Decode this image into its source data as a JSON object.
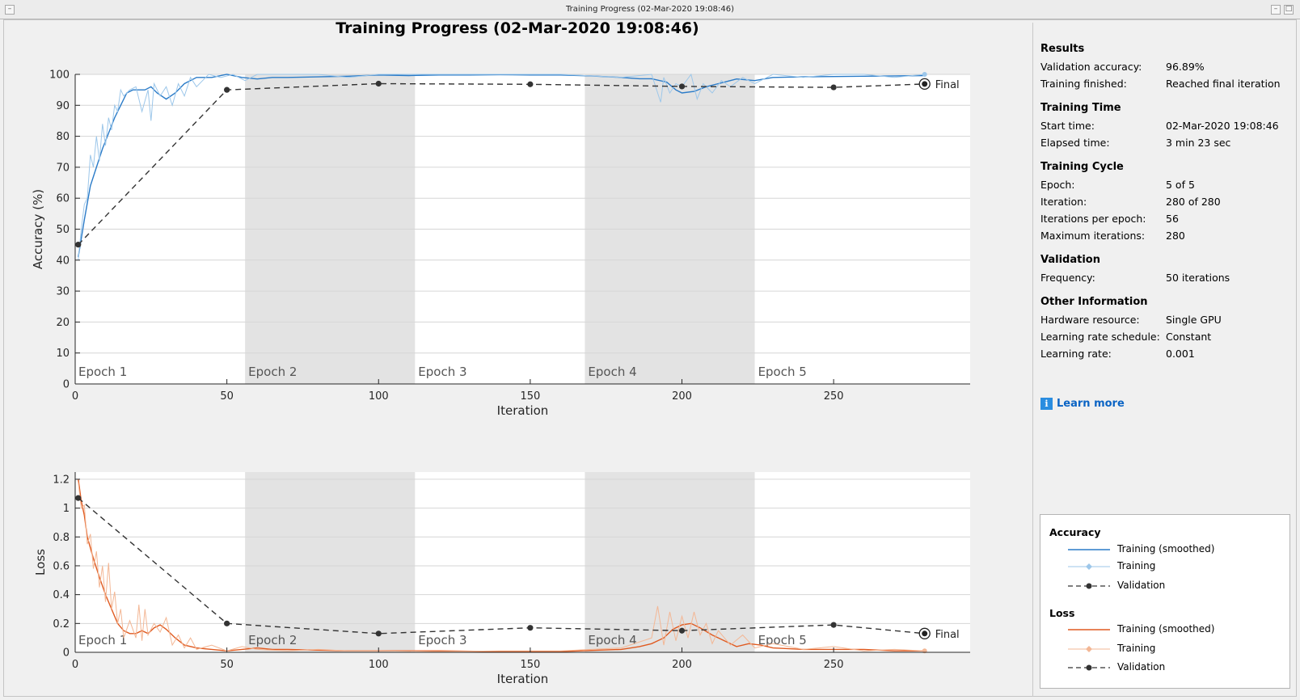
{
  "window": {
    "title": "Training Progress (02-Mar-2020 19:08:46)"
  },
  "main_title": "Training Progress (02-Mar-2020 19:08:46)",
  "colors": {
    "accuracy_smoothed": "#2a7bc8",
    "accuracy_raw": "#9dc7ea",
    "loss_smoothed": "#e05a20",
    "loss_raw": "#f3b795",
    "validation": "#333333",
    "epoch_shade": "#e3e3e3"
  },
  "chart_data": [
    {
      "type": "line",
      "name": "accuracy",
      "xlabel": "Iteration",
      "ylabel": "Accuracy (%)",
      "xlim": [
        0,
        295
      ],
      "ylim": [
        0,
        100
      ],
      "xticks": [
        0,
        50,
        100,
        150,
        200,
        250
      ],
      "yticks": [
        0,
        10,
        20,
        30,
        40,
        50,
        60,
        70,
        80,
        90,
        100
      ],
      "ytick_labels": [
        "0",
        "10",
        "20",
        "30",
        "40",
        "50",
        "60",
        "70",
        "80",
        "90",
        "100"
      ],
      "epochs": [
        "Epoch 1",
        "Epoch 2",
        "Epoch 3",
        "Epoch 4",
        "Epoch 5"
      ],
      "epoch_bounds": [
        0,
        56,
        112,
        168,
        224,
        280
      ],
      "final_label": "Final",
      "series": [
        {
          "name": "Training (smoothed)",
          "style": "smoothed",
          "x": [
            1,
            3,
            5,
            7,
            9,
            11,
            13,
            15,
            17,
            19,
            21,
            23,
            25,
            27,
            30,
            33,
            36,
            40,
            45,
            50,
            55,
            60,
            65,
            70,
            80,
            90,
            100,
            110,
            120,
            130,
            140,
            150,
            160,
            170,
            180,
            186,
            190,
            195,
            198,
            200,
            204,
            208,
            212,
            218,
            224,
            230,
            240,
            250,
            260,
            270,
            280
          ],
          "y": [
            41,
            53,
            64,
            70,
            76,
            81,
            86,
            90,
            94,
            95,
            95,
            95,
            96,
            94,
            92,
            94,
            97,
            99,
            99,
            100,
            99,
            98.5,
            99,
            99,
            99.2,
            99.4,
            99.8,
            99.6,
            99.8,
            99.8,
            99.9,
            99.8,
            99.8,
            99.5,
            99,
            98.6,
            98.6,
            97.5,
            95,
            94,
            94.5,
            96,
            97,
            98.5,
            98,
            99,
            99.2,
            99.3,
            99.4,
            99.5,
            99.6
          ]
        },
        {
          "name": "Training",
          "style": "raw",
          "x": [
            1,
            2,
            3,
            4,
            5,
            6,
            7,
            8,
            9,
            10,
            11,
            12,
            13,
            14,
            15,
            16,
            18,
            20,
            22,
            24,
            25,
            26,
            28,
            30,
            32,
            34,
            36,
            38,
            40,
            44,
            48,
            52,
            56,
            60,
            70,
            80,
            90,
            100,
            120,
            140,
            160,
            180,
            190,
            193,
            194,
            196,
            198,
            200,
            203,
            205,
            207,
            210,
            213,
            216,
            220,
            224,
            230,
            240,
            250,
            260,
            270,
            280
          ],
          "y": [
            40,
            50,
            58,
            60,
            74,
            70,
            80,
            72,
            84,
            77,
            86,
            82,
            90,
            88,
            95,
            93,
            95,
            96,
            88,
            95,
            85,
            97,
            93,
            96,
            90,
            97,
            93,
            99,
            96,
            100,
            99,
            100,
            98,
            100,
            100,
            100,
            99,
            100,
            100,
            100,
            100,
            99,
            100,
            91,
            99,
            94,
            97,
            96,
            100,
            92,
            97,
            94,
            98,
            96,
            99,
            97,
            100,
            99,
            100,
            100,
            99,
            100
          ]
        },
        {
          "name": "Validation",
          "style": "validation",
          "x": [
            1,
            50,
            100,
            150,
            200,
            250,
            280
          ],
          "y": [
            45,
            95,
            97,
            96.8,
            96.1,
            95.8,
            96.9
          ]
        }
      ]
    },
    {
      "type": "line",
      "name": "loss",
      "xlabel": "Iteration",
      "ylabel": "Loss",
      "xlim": [
        0,
        295
      ],
      "ylim": [
        0,
        1.25
      ],
      "xticks": [
        0,
        50,
        100,
        150,
        200,
        250
      ],
      "yticks": [
        0,
        0.2,
        0.4,
        0.6,
        0.8,
        1.0,
        1.2
      ],
      "ytick_labels": [
        "0",
        "0.2",
        "0.4",
        "0.6",
        "0.8",
        "1",
        "1.2"
      ],
      "epochs": [
        "Epoch 1",
        "Epoch 2",
        "Epoch 3",
        "Epoch 4",
        "Epoch 5"
      ],
      "epoch_bounds": [
        0,
        56,
        112,
        168,
        224,
        280
      ],
      "final_label": "Final",
      "series": [
        {
          "name": "Training (smoothed)",
          "style": "smoothed",
          "x": [
            1,
            2,
            3,
            4,
            6,
            8,
            10,
            12,
            14,
            16,
            18,
            20,
            22,
            24,
            26,
            28,
            30,
            33,
            36,
            40,
            45,
            50,
            55,
            60,
            65,
            70,
            80,
            90,
            100,
            120,
            140,
            160,
            180,
            186,
            190,
            194,
            197,
            200,
            203,
            206,
            210,
            214,
            218,
            222,
            226,
            230,
            240,
            250,
            260,
            270,
            280
          ],
          "y": [
            1.2,
            1.05,
            0.95,
            0.8,
            0.65,
            0.52,
            0.4,
            0.3,
            0.2,
            0.15,
            0.13,
            0.13,
            0.15,
            0.13,
            0.17,
            0.19,
            0.16,
            0.1,
            0.05,
            0.03,
            0.02,
            0.01,
            0.02,
            0.03,
            0.02,
            0.02,
            0.015,
            0.01,
            0.01,
            0.01,
            0.005,
            0.005,
            0.02,
            0.04,
            0.06,
            0.1,
            0.16,
            0.19,
            0.2,
            0.17,
            0.12,
            0.08,
            0.04,
            0.06,
            0.05,
            0.03,
            0.02,
            0.02,
            0.02,
            0.01,
            0.01
          ]
        },
        {
          "name": "Training",
          "style": "raw",
          "x": [
            1,
            2,
            3,
            4,
            5,
            6,
            7,
            8,
            9,
            10,
            11,
            12,
            13,
            14,
            15,
            16,
            18,
            20,
            21,
            22,
            23,
            24,
            26,
            28,
            30,
            32,
            34,
            36,
            38,
            40,
            45,
            50,
            55,
            60,
            70,
            80,
            90,
            100,
            120,
            140,
            160,
            180,
            190,
            192,
            194,
            196,
            198,
            200,
            202,
            204,
            206,
            208,
            210,
            212,
            216,
            220,
            224,
            230,
            240,
            250,
            260,
            270,
            280
          ],
          "y": [
            1.18,
            1.0,
            1.02,
            0.75,
            0.82,
            0.58,
            0.7,
            0.45,
            0.6,
            0.35,
            0.62,
            0.3,
            0.42,
            0.2,
            0.3,
            0.1,
            0.22,
            0.1,
            0.33,
            0.08,
            0.3,
            0.12,
            0.2,
            0.14,
            0.24,
            0.05,
            0.12,
            0.03,
            0.1,
            0.02,
            0.05,
            0.01,
            0.04,
            0.02,
            0.01,
            0.02,
            0.01,
            0.01,
            0.005,
            0.01,
            0.01,
            0.03,
            0.1,
            0.32,
            0.05,
            0.28,
            0.08,
            0.25,
            0.1,
            0.28,
            0.12,
            0.2,
            0.06,
            0.15,
            0.05,
            0.12,
            0.03,
            0.06,
            0.02,
            0.04,
            0.01,
            0.02,
            0.01
          ]
        },
        {
          "name": "Validation",
          "style": "validation",
          "x": [
            1,
            50,
            100,
            150,
            200,
            250,
            280
          ],
          "y": [
            1.07,
            0.2,
            0.13,
            0.17,
            0.15,
            0.19,
            0.13
          ]
        }
      ]
    }
  ],
  "panel": {
    "results": {
      "heading": "Results",
      "rows": [
        {
          "label": "Validation accuracy:",
          "value": "96.89%"
        },
        {
          "label": "Training finished:",
          "value": "Reached final iteration"
        }
      ]
    },
    "training_time": {
      "heading": "Training Time",
      "rows": [
        {
          "label": "Start time:",
          "value": "02-Mar-2020 19:08:46"
        },
        {
          "label": "Elapsed time:",
          "value": "3 min 23 sec"
        }
      ]
    },
    "training_cycle": {
      "heading": "Training Cycle",
      "rows": [
        {
          "label": "Epoch:",
          "value": "5 of 5"
        },
        {
          "label": "Iteration:",
          "value": "280 of 280"
        },
        {
          "label": "Iterations per epoch:",
          "value": "56"
        },
        {
          "label": "Maximum iterations:",
          "value": "280"
        }
      ]
    },
    "validation": {
      "heading": "Validation",
      "rows": [
        {
          "label": "Frequency:",
          "value": "50 iterations"
        }
      ]
    },
    "other": {
      "heading": "Other Information",
      "rows": [
        {
          "label": "Hardware resource:",
          "value": "Single GPU"
        },
        {
          "label": "Learning rate schedule:",
          "value": "Constant"
        },
        {
          "label": "Learning rate:",
          "value": "0.001"
        }
      ]
    },
    "learn_more": "Learn more",
    "info_icon_glyph": "i"
  },
  "legend": {
    "accuracy": {
      "heading": "Accuracy",
      "items": [
        "Training (smoothed)",
        "Training",
        "Validation"
      ]
    },
    "loss": {
      "heading": "Loss",
      "items": [
        "Training (smoothed)",
        "Training",
        "Validation"
      ]
    }
  }
}
